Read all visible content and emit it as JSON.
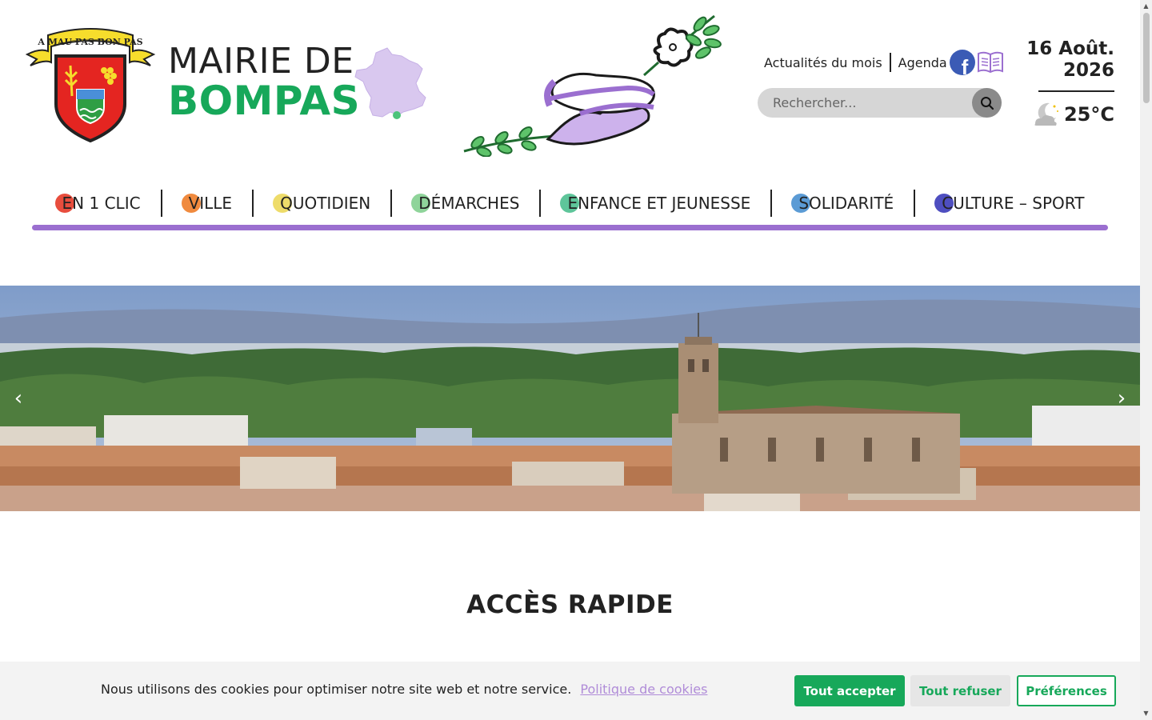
{
  "header": {
    "crest_motto": "A MAU PAS BON PAS",
    "title_line1": "MAIRIE DE",
    "title_line2": "BOMPAS",
    "links": [
      "Actualités du mois",
      "Agenda"
    ],
    "search_placeholder": "Rechercher...",
    "date": "16 Août.\n2026",
    "date_line1": "16 Août.",
    "date_line2": "2026",
    "temperature": "25°C",
    "weather_icon": "moon-cloud-icon"
  },
  "nav": {
    "items": [
      {
        "label": "EN 1 CLIC",
        "color": "#e84d3d"
      },
      {
        "label": "VILLE",
        "color": "#f08a3e"
      },
      {
        "label": "QUOTIDIEN",
        "color": "#eedc6a"
      },
      {
        "label": "DÉMARCHES",
        "color": "#8fd49a"
      },
      {
        "label": "ENFANCE ET JEUNESSE",
        "color": "#5ec59a"
      },
      {
        "label": "SOLIDARITÉ",
        "color": "#5b9bd5"
      },
      {
        "label": "CULTURE – SPORT",
        "color": "#4e4ec0"
      }
    ],
    "bar_color": "#9b6fd0"
  },
  "hero": {
    "prev_icon": "chevron-left-icon",
    "next_icon": "chevron-right-icon"
  },
  "sections": {
    "quick_access_title": "ACCÈS RAPIDE"
  },
  "cookie": {
    "message": "Nous utilisons des cookies pour optimiser notre site web et notre service.",
    "policy_link": "Politique de cookies",
    "accept": "Tout accepter",
    "refuse": "Tout refuser",
    "preferences": "Préférences"
  },
  "colors": {
    "brand_green": "#17a85a",
    "accent_purple": "#9b6fd0",
    "facebook_blue": "#3b5bb5"
  }
}
